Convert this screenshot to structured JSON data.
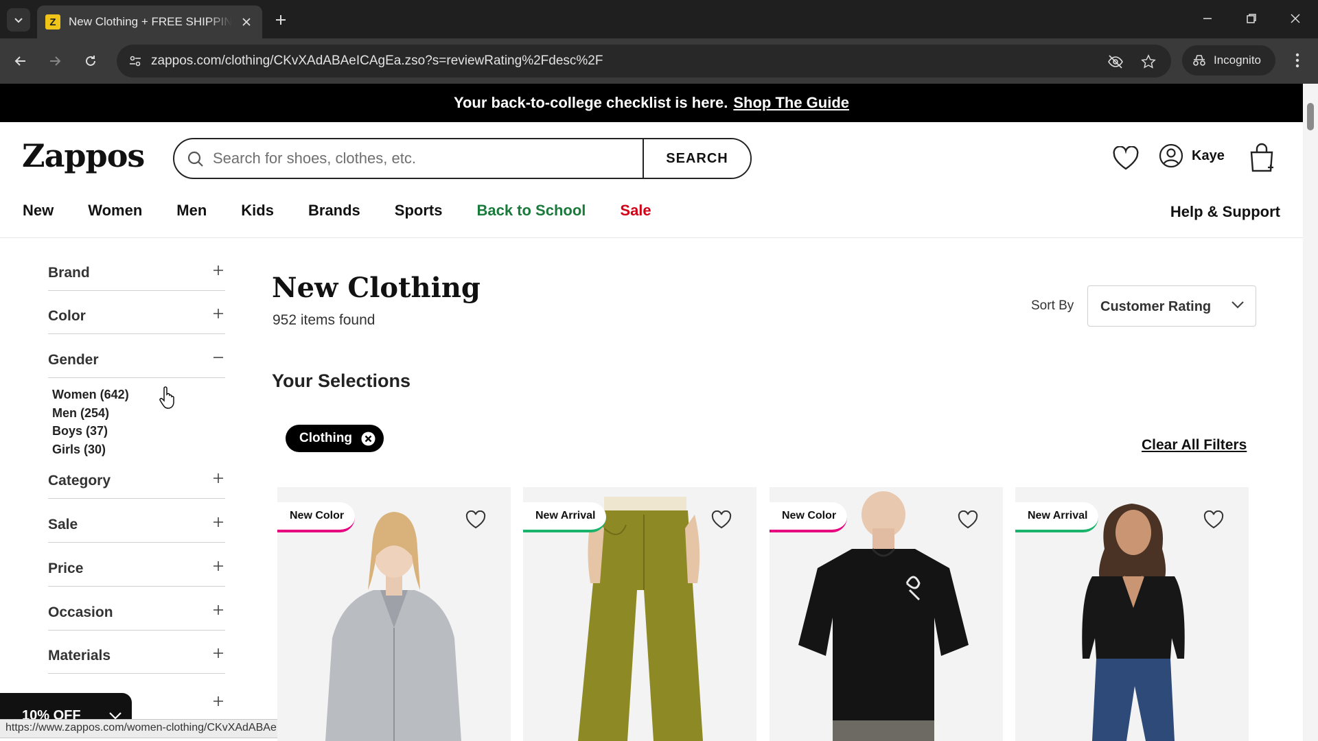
{
  "browser": {
    "tab_title": "New Clothing + FREE SHIPPING",
    "favicon_letter": "Z",
    "url": "zappos.com/clothing/CKvXAdABAeICAgEa.zso?s=reviewRating%2Fdesc%2F",
    "incognito_label": "Incognito",
    "status_url": "https://www.zappos.com/women-clothing/CKvXAdABAeICAwEYGg.zso?s=re..."
  },
  "promo": {
    "text": "Your back-to-college checklist is here.",
    "link": "Shop The Guide"
  },
  "header": {
    "logo": "Zappos",
    "search_placeholder": "Search for shoes, clothes, etc.",
    "search_button": "SEARCH",
    "account_name": "Kaye"
  },
  "nav": {
    "items": [
      "New",
      "Women",
      "Men",
      "Kids",
      "Brands",
      "Sports",
      "Back to School",
      "Sale"
    ],
    "help": "Help & Support"
  },
  "sidebar": {
    "facets": [
      "Brand",
      "Color",
      "Gender",
      "Category",
      "Sale",
      "Price",
      "Occasion",
      "Materials"
    ],
    "gender_options": [
      "Women (642)",
      "Men (254)",
      "Boys (37)",
      "Girls (30)"
    ],
    "offer": "10% OFF"
  },
  "main": {
    "title": "New Clothing",
    "count": "952 items found",
    "sort_label": "Sort By",
    "sort_value": "Customer Rating",
    "selections_heading": "Your Selections",
    "chip": "Clothing",
    "clear_all": "Clear All Filters"
  },
  "products": [
    {
      "badge": "New Color",
      "badge_color": "#e6007e"
    },
    {
      "badge": "New Arrival",
      "badge_color": "#19b36b"
    },
    {
      "badge": "New Color",
      "badge_color": "#e6007e"
    },
    {
      "badge": "New Arrival",
      "badge_color": "#19b36b"
    }
  ],
  "colors": {
    "promo_bg": "#000000",
    "back_to_school": "#1a7a3c",
    "sale": "#d10016"
  }
}
